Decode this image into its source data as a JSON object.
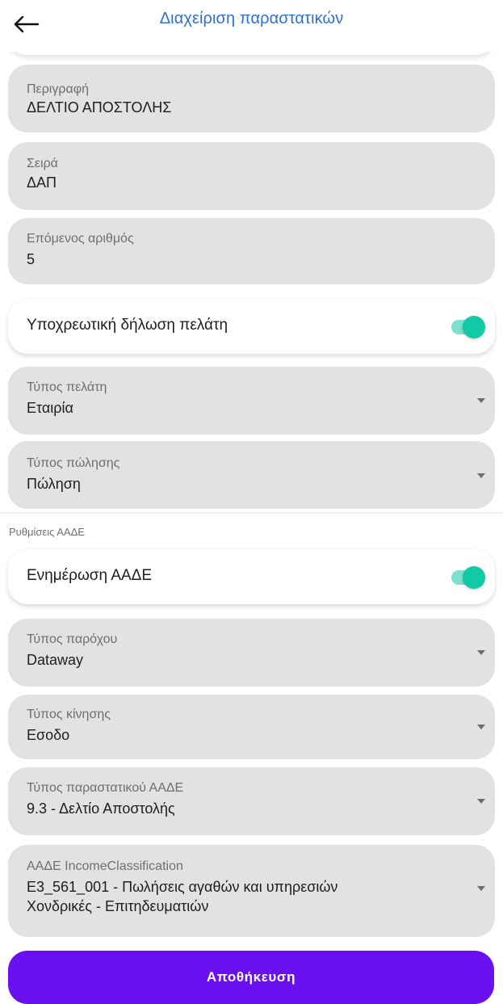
{
  "header": {
    "title": "Διαχείριση παραστατικών",
    "back_icon": "arrow-left-icon"
  },
  "form": {
    "description": {
      "label": "Περιγραφή",
      "value": "ΔΕΛΤΙΟ ΑΠΟΣΤΟΛΗΣ"
    },
    "series": {
      "label": "Σειρά",
      "value": "ΔΑΠ"
    },
    "next_number": {
      "label": "Επόμενος αριθμός",
      "value": "5"
    },
    "mandatory_customer": {
      "label": "Υποχρεωτική δήλωση πελάτη",
      "enabled": true
    },
    "customer_type": {
      "label": "Τύπος πελάτη",
      "value": "Εταιρία"
    },
    "sale_type": {
      "label": "Τύπος πώλησης",
      "value": "Πώληση"
    }
  },
  "aade": {
    "section_title": "Ρυθμίσεις ΑΑΔΕ",
    "update": {
      "label": "Ενημέρωση ΑΑΔΕ",
      "enabled": true
    },
    "provider_type": {
      "label": "Τύπος παρόχου",
      "value": "Dataway"
    },
    "movement_type": {
      "label": "Τύπος κίνησης",
      "value": "Εσοδο"
    },
    "document_type": {
      "label": "Τύπος παραστατικού ΑΑΔΕ",
      "value": "9.3 - Δελτίο Αποστολής"
    },
    "income_classification": {
      "label": "ΑΑΔΕ IncomeClassification",
      "value_line1": "Ε3_561_001 - Πωλήσεις αγαθών και υπηρεσιών",
      "value_line2": "Χονδρικές - Επιτηδευματιών"
    }
  },
  "actions": {
    "save_label": "Αποθήκευση"
  },
  "colors": {
    "title": "#2f6fd0",
    "switch_on": "#12c9a5",
    "save_button": "#6a0ff0",
    "field_bg": "#e2e2e2"
  }
}
